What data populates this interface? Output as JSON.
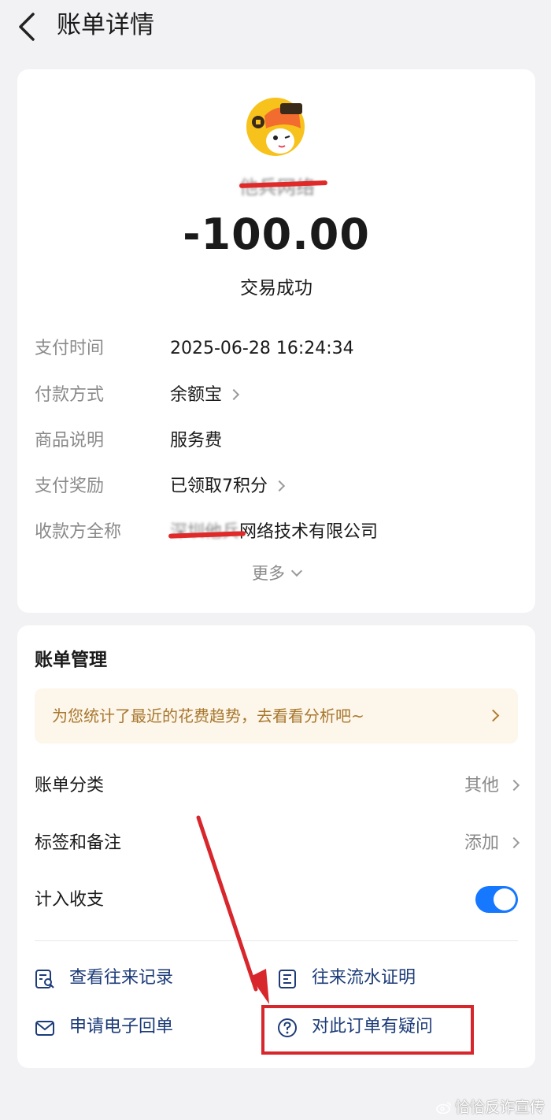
{
  "header": {
    "title": "账单详情"
  },
  "detail": {
    "merchant_name": "他兵网络",
    "amount": "-100.00",
    "status": "交易成功",
    "rows": [
      {
        "label": "支付时间",
        "value": "2025-06-28 16:24:34"
      },
      {
        "label": "付款方式",
        "value": "余额宝"
      },
      {
        "label": "商品说明",
        "value": "服务费"
      },
      {
        "label": "支付奖励",
        "value": "已领取7积分"
      },
      {
        "label": "收款方全称",
        "value_redacted": "深圳他兵",
        "value": "网络技术有限公司"
      }
    ],
    "more_label": "更多"
  },
  "manage": {
    "title": "账单管理",
    "banner_text": "为您统计了最近的花费趋势，去看看分析吧~",
    "category": {
      "label": "账单分类",
      "value": "其他"
    },
    "tags": {
      "label": "标签和备注",
      "value": "添加"
    },
    "include": {
      "label": "计入收支",
      "on": true
    },
    "actions": [
      {
        "label": "查看往来记录",
        "icon": "record-search-icon"
      },
      {
        "label": "往来流水证明",
        "icon": "statement-doc-icon"
      },
      {
        "label": "申请电子回单",
        "icon": "envelope-icon"
      },
      {
        "label": "对此订单有疑问",
        "icon": "question-circle-icon"
      }
    ]
  },
  "annotation": {
    "color": "#d7262c"
  },
  "watermark": "恰恰反诈宣传",
  "colors": {
    "accent": "#1677ff",
    "banner_text": "#a8772e",
    "link": "#1c3b78"
  }
}
